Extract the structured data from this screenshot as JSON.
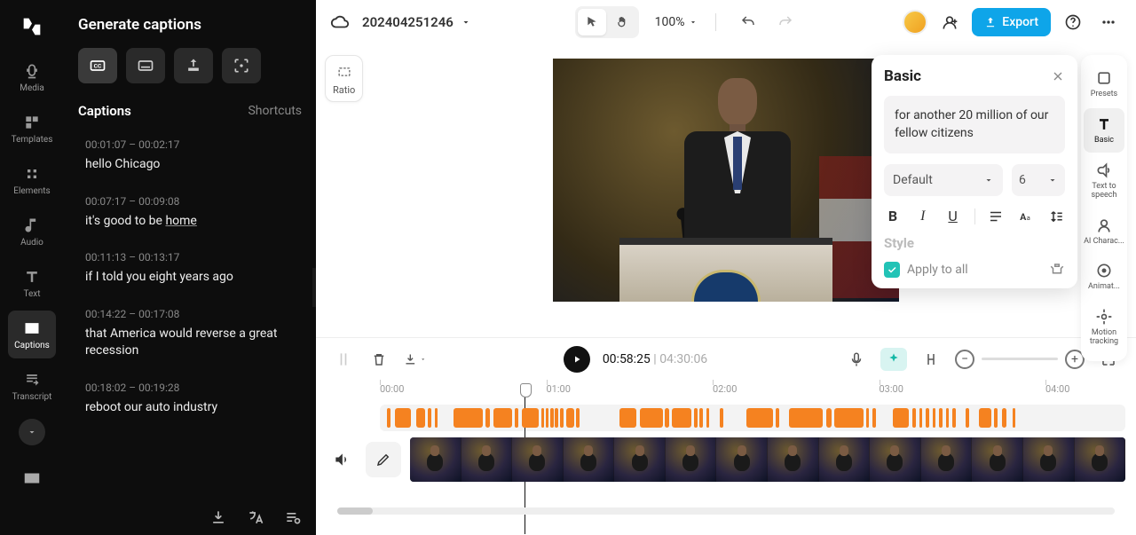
{
  "nav": {
    "items": [
      {
        "id": "media",
        "label": "Media"
      },
      {
        "id": "templates",
        "label": "Templates"
      },
      {
        "id": "elements",
        "label": "Elements"
      },
      {
        "id": "audio",
        "label": "Audio"
      },
      {
        "id": "text",
        "label": "Text"
      },
      {
        "id": "captions",
        "label": "Captions"
      },
      {
        "id": "transcript",
        "label": "Transcript"
      }
    ]
  },
  "leftPanel": {
    "title": "Generate captions",
    "sectionTitle": "Captions",
    "shortcuts": "Shortcuts"
  },
  "captions": [
    {
      "time": "00:01:07 – 00:02:17",
      "text": "hello Chicago"
    },
    {
      "time": "00:07:17 – 00:09:08",
      "text": "it's good to be ",
      "u": "home"
    },
    {
      "time": "00:11:13 – 00:13:17",
      "text": "if I told you eight years ago"
    },
    {
      "time": "00:14:22 – 00:17:08",
      "text": "that America would reverse a great recession"
    },
    {
      "time": "00:18:02 – 00:19:28",
      "text": "reboot our auto industry"
    }
  ],
  "topbar": {
    "projectName": "202404251246",
    "zoom": "100%",
    "export": "Export"
  },
  "ratio": {
    "label": "Ratio"
  },
  "basicPanel": {
    "title": "Basic",
    "captionText": "for another 20 million of our fellow citizens",
    "font": "Default",
    "size": "6",
    "styleLabel": "Style",
    "applyAll": "Apply to all"
  },
  "rightRail": {
    "items": [
      {
        "id": "presets",
        "label": "Presets"
      },
      {
        "id": "basic",
        "label": "Basic"
      },
      {
        "id": "tts",
        "label": "Text to speech"
      },
      {
        "id": "aichar",
        "label": "AI Charac..."
      },
      {
        "id": "anim",
        "label": "Animat..."
      },
      {
        "id": "motion",
        "label": "Motion tracking"
      }
    ]
  },
  "playback": {
    "current": "00:58:25",
    "sep": " | ",
    "duration": "04:30:06"
  },
  "ruler": [
    "00:00",
    "01:00",
    "02:00",
    "03:00",
    "04:00"
  ],
  "capSegments": [
    [
      1,
      0.6
    ],
    [
      2.2,
      2.5
    ],
    [
      5.4,
      1.4
    ],
    [
      7.2,
      0.5
    ],
    [
      8.2,
      0.5
    ],
    [
      11,
      4.5
    ],
    [
      15.8,
      0.7
    ],
    [
      17,
      2.8
    ],
    [
      20.2,
      0.6
    ],
    [
      21.3,
      2.5
    ],
    [
      24.2,
      0.5
    ],
    [
      24.9,
      0.4
    ],
    [
      25.6,
      0.5
    ],
    [
      26.3,
      0.5
    ],
    [
      27.1,
      0.5
    ],
    [
      28,
      1.2
    ],
    [
      29.5,
      0.5
    ],
    [
      36,
      2.5
    ],
    [
      39,
      3.5
    ],
    [
      42.8,
      0.6
    ],
    [
      43.8,
      3
    ],
    [
      47.2,
      0.5
    ],
    [
      48,
      0.5
    ],
    [
      49,
      0.5
    ],
    [
      51,
      0.6
    ],
    [
      55,
      4
    ],
    [
      59.5,
      0.5
    ],
    [
      61.5,
      5
    ],
    [
      67,
      0.8
    ],
    [
      68.2,
      4.5
    ],
    [
      73,
      0.5
    ],
    [
      74,
      0.5
    ],
    [
      77,
      2.5
    ],
    [
      80,
      0.5
    ],
    [
      81,
      0.5
    ],
    [
      82,
      0.5
    ],
    [
      83,
      0.5
    ],
    [
      84,
      0.5
    ],
    [
      85,
      0.5
    ],
    [
      86,
      0.5
    ],
    [
      88,
      0.5
    ],
    [
      90,
      1.8
    ],
    [
      92.2,
      0.6
    ],
    [
      93.5,
      0.6
    ],
    [
      95,
      0.5
    ]
  ],
  "chart_data": null
}
